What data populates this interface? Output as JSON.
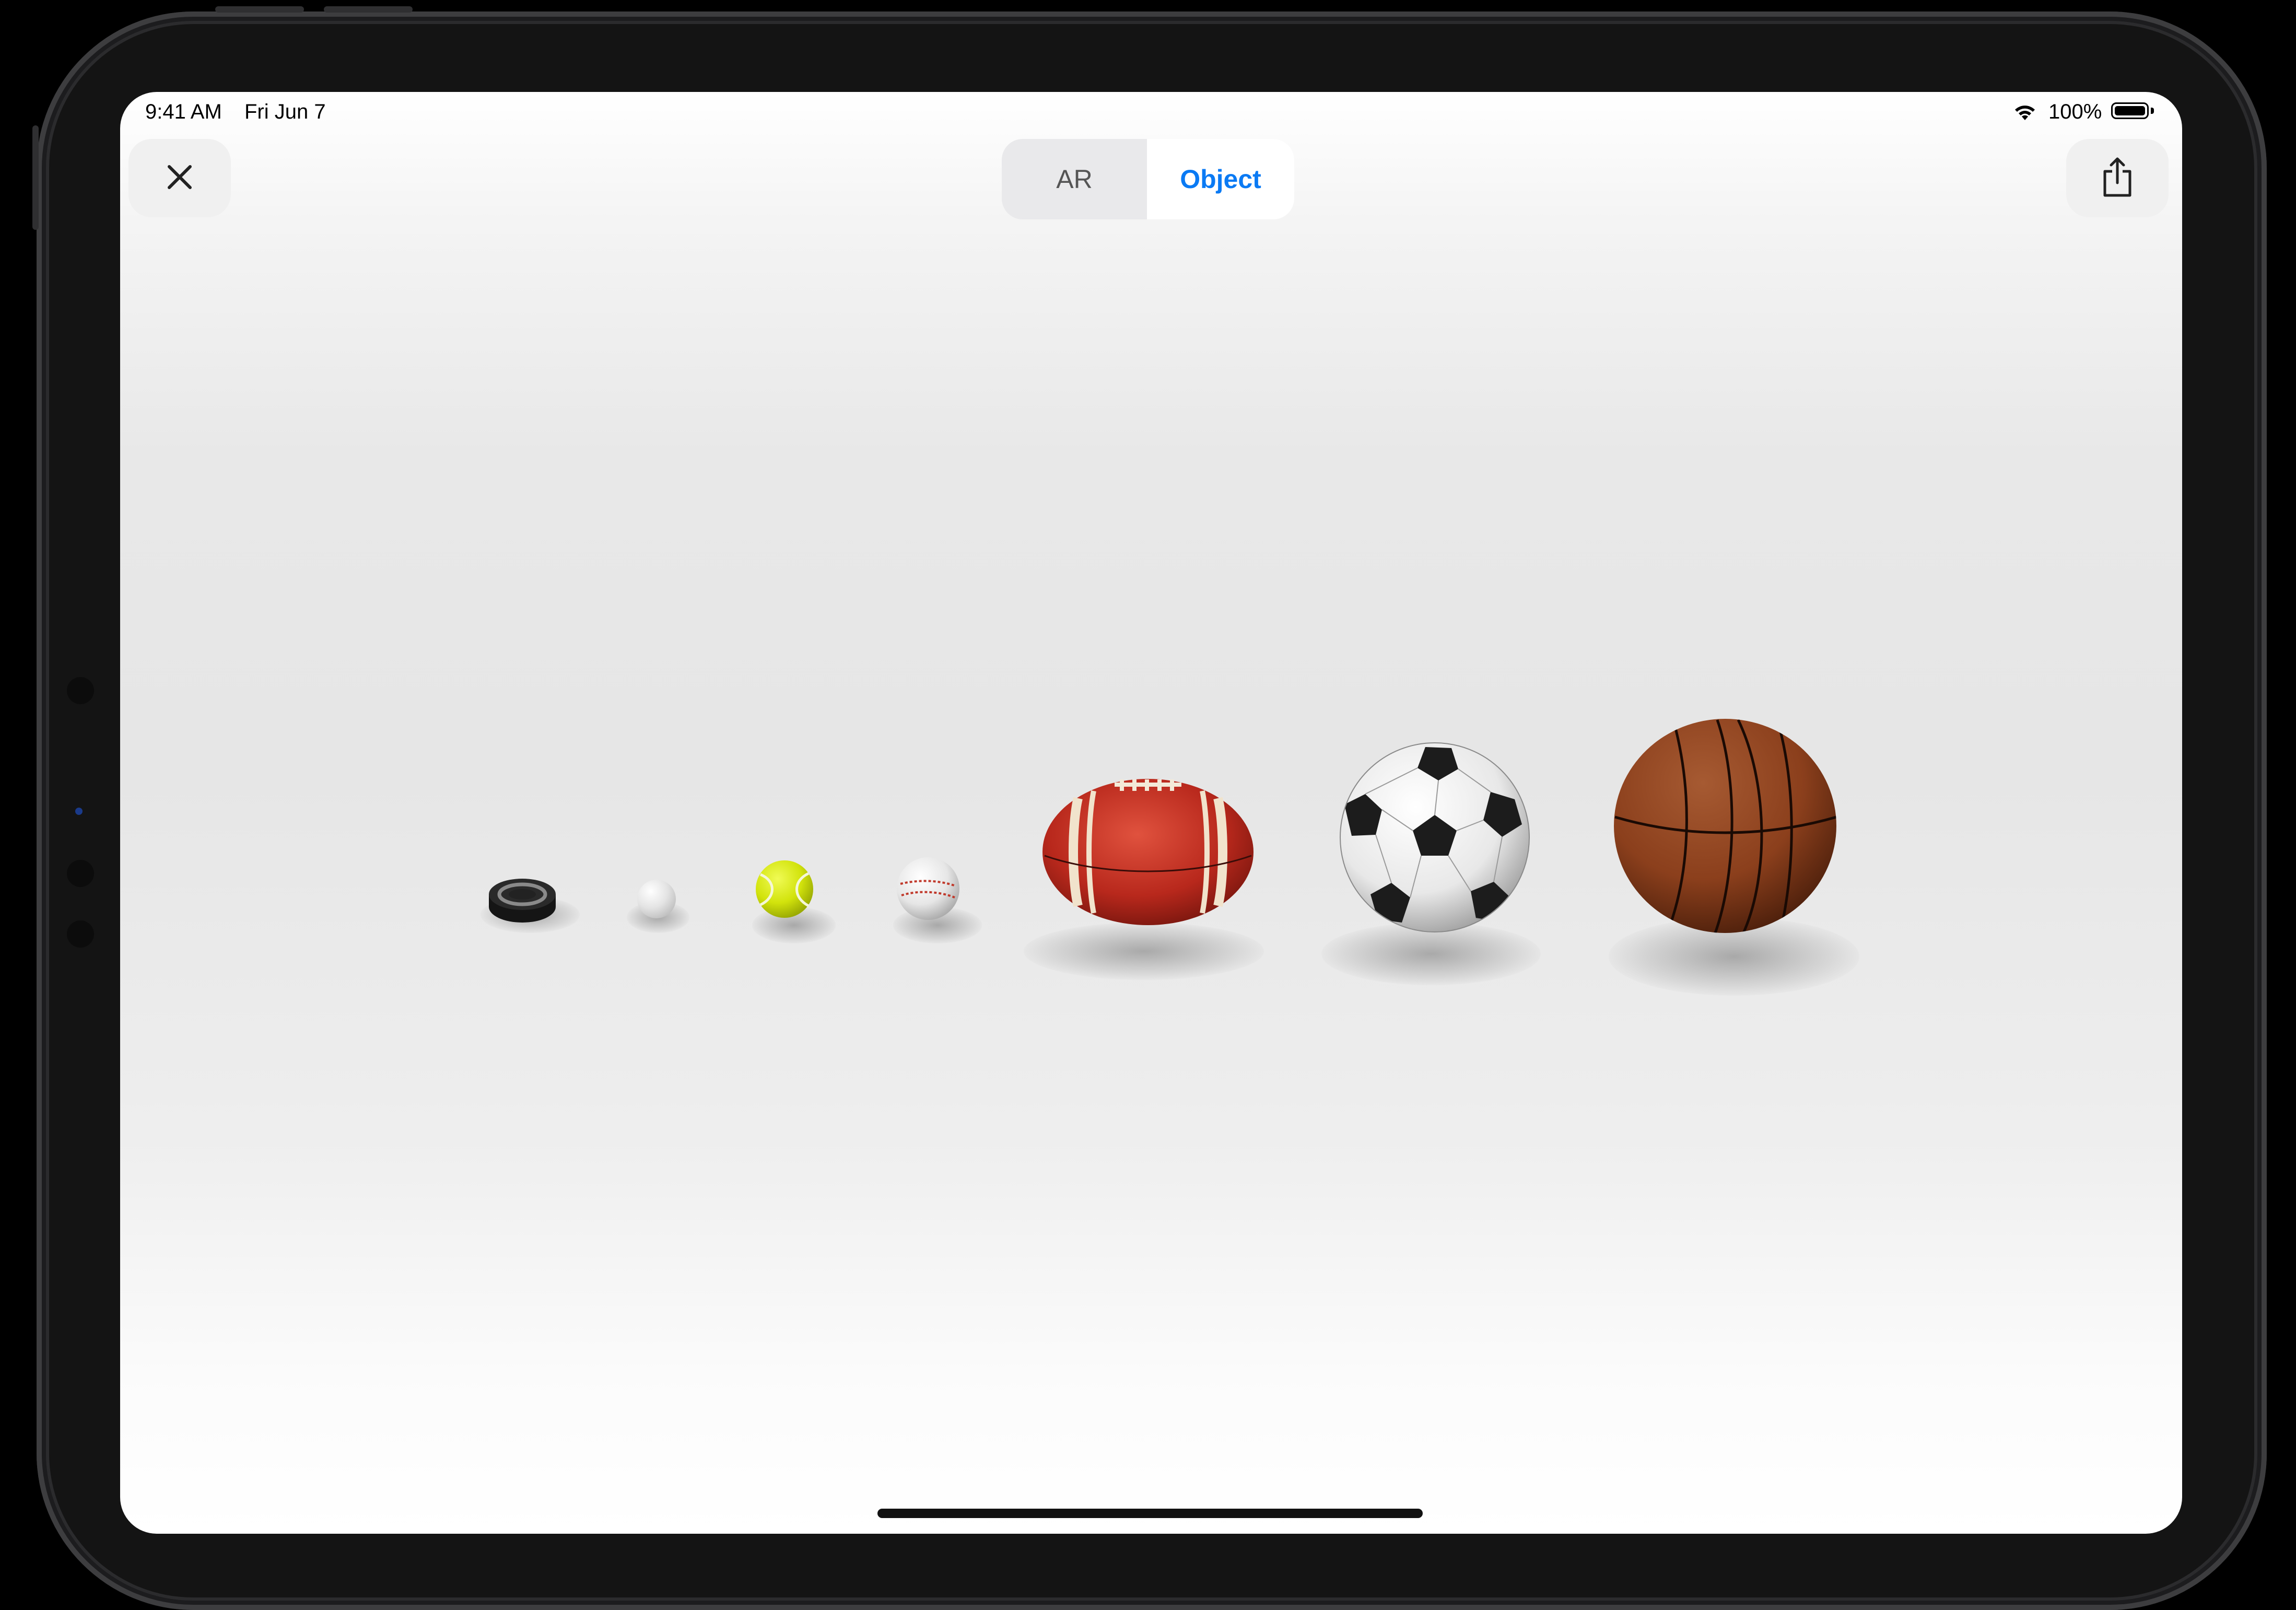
{
  "status_bar": {
    "time": "9:41 AM",
    "date": "Fri Jun 7",
    "battery_percent": "100%",
    "battery_level": 1.0
  },
  "toolbar": {
    "close_icon": "xmark-icon",
    "share_icon": "share-icon",
    "mode_options": [
      "AR",
      "Object"
    ],
    "selected_mode": "Object"
  },
  "scene": {
    "objects": [
      "hockey-puck",
      "golf-ball",
      "tennis-ball",
      "baseball",
      "american-football",
      "soccer-ball",
      "basketball"
    ]
  },
  "colors": {
    "accent": "#0a7af4",
    "background_top": "#ffffff",
    "background_mid": "#e6e6e6",
    "tennis_ball": "#d8e80f",
    "football": "#b8281c",
    "basketball": "#8b3f1c"
  }
}
